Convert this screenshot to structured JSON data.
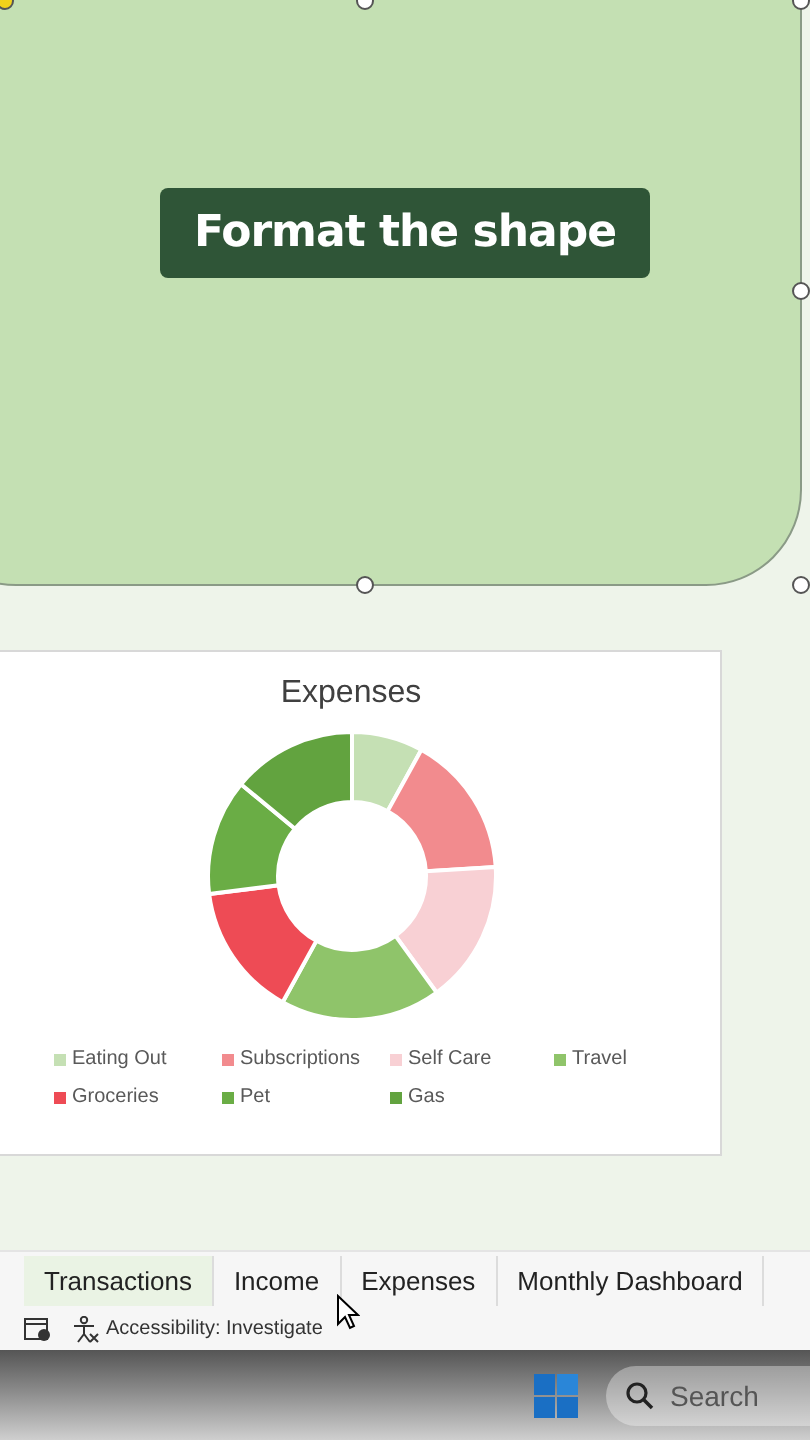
{
  "shape": {
    "caption": "Format the shape"
  },
  "chart": {
    "title": "Expenses",
    "legend": [
      {
        "label": "Eating Out",
        "color": "#c5e0b4"
      },
      {
        "label": "Subscriptions",
        "color": "#f28b8e"
      },
      {
        "label": "Self Care",
        "color": "#f8d0d4"
      },
      {
        "label": "Travel",
        "color": "#8fc46a"
      },
      {
        "label": "Groceries",
        "color": "#ee4b55"
      },
      {
        "label": "Pet",
        "color": "#6aad45"
      },
      {
        "label": "Gas",
        "color": "#62a33f"
      }
    ]
  },
  "sheet_tabs": [
    {
      "label": "Transactions",
      "selected": true
    },
    {
      "label": "Income",
      "selected": false
    },
    {
      "label": "Expenses",
      "selected": false
    },
    {
      "label": "Monthly Dashboard",
      "selected": false
    }
  ],
  "status_bar": {
    "accessibility": "Accessibility: Investigate"
  },
  "taskbar": {
    "search_placeholder": "Search"
  }
}
